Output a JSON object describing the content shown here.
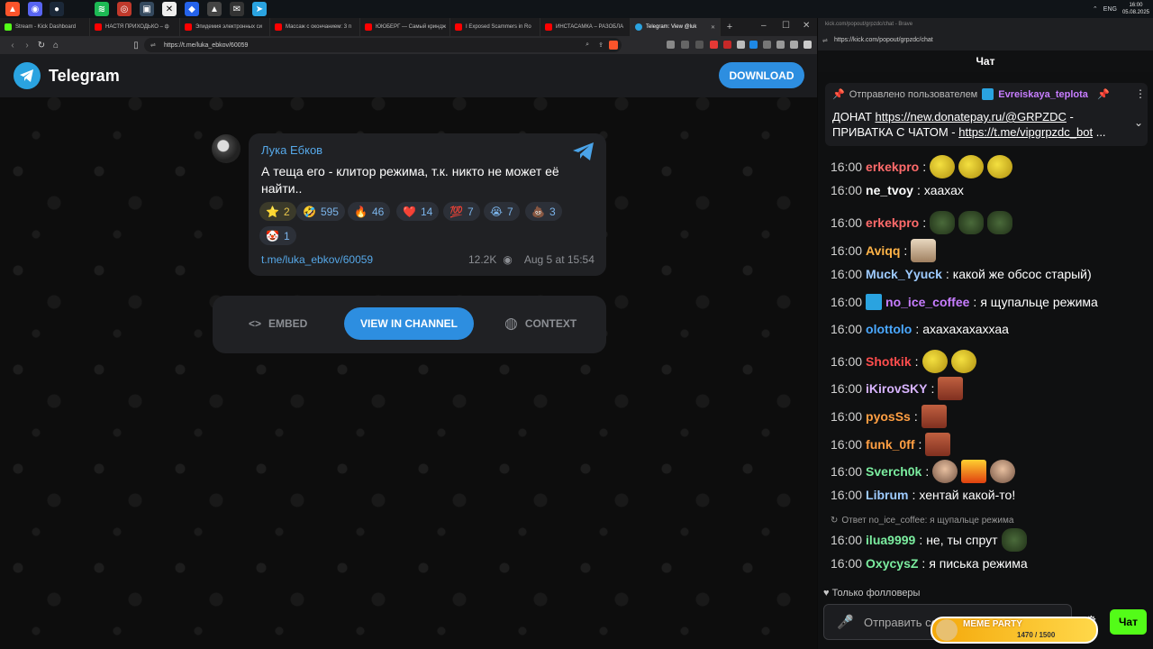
{
  "taskbar": {
    "lang": "ENG",
    "time": "16:00",
    "date": "05.08.2025"
  },
  "browser": {
    "tabs": [
      {
        "label": "Stream - Kick Dashboard",
        "color": "#53fc18"
      },
      {
        "label": "НАСТЯ ПРИХОДЬКО – ф",
        "color": "#ff0000"
      },
      {
        "label": "Эпидемия электронных си",
        "color": "#ff0000"
      },
      {
        "label": "Массаж с окончанием: 3 п",
        "color": "#ff0000"
      },
      {
        "label": "ЮЮБЕРГ — Самый криндж",
        "color": "#ff0000"
      },
      {
        "label": "I Exposed Scammers in Ro",
        "color": "#ff0000"
      },
      {
        "label": "ИНСТАСАМКА – РАЗОБЛА",
        "color": "#ff0000"
      },
      {
        "label": "Telegram: View @luk",
        "color": "#2aa3e0",
        "active": true
      }
    ],
    "url": "https://t.me/luka_ebkov/60059"
  },
  "telegram": {
    "brand": "Telegram",
    "download_label": "DOWNLOAD",
    "post": {
      "author": "Лука Ебков",
      "text": "А теща его - клитор режима, т.к. никто не может её найти..",
      "reactions": [
        {
          "emoji": "⭐",
          "count": "2"
        },
        {
          "emoji": "🤣",
          "count": "595"
        },
        {
          "emoji": "🔥",
          "count": "46"
        },
        {
          "emoji": "❤️",
          "count": "14"
        },
        {
          "emoji": "💯",
          "count": "7"
        },
        {
          "emoji": "😭",
          "count": "7"
        },
        {
          "emoji": "💩",
          "count": "3"
        },
        {
          "emoji": "🤡",
          "count": "1"
        }
      ],
      "link": "t.me/luka_ebkov/60059",
      "views": "12.2K",
      "date": "Aug 5 at 15:54"
    },
    "actions": {
      "embed": "EMBED",
      "view": "VIEW IN CHANNEL",
      "context": "CONTEXT"
    }
  },
  "kick": {
    "window_title": "kick.com/popout/grpzdc/chat - Brave",
    "url": "https://kick.com/popout/grpzdc/chat",
    "header": "Чат",
    "pinned": {
      "by_label": "Отправлено пользователем",
      "by_user": "Evreiskaya_teplota",
      "text1": "ДОНАТ ",
      "link1": "https://new.donatepay.ru/@GRPZDC",
      "text2": " - ПРИВАТКА С ЧАТОМ - ",
      "link2": "https://t.me/vipgrpzdc_bot",
      "ellipsis": " ..."
    },
    "messages": [
      {
        "time": "16:00",
        "user": "erkekpro",
        "color": "#ff6b6b",
        "text": "",
        "emotes": [
          "",
          "",
          ""
        ]
      },
      {
        "time": "16:00",
        "user": "ne_tvoy",
        "color": "#ffffff",
        "text": "хаахах",
        "emotes": []
      },
      {
        "time": "16:00",
        "user": "erkekpro",
        "color": "#ff6b6b",
        "text": "",
        "emotes": [
          "frog",
          "frog",
          "frog"
        ]
      },
      {
        "time": "16:00",
        "user": "Aviqq",
        "color": "#ffb347",
        "text": "",
        "emotes": [
          "cat"
        ]
      },
      {
        "time": "16:00",
        "user": "Muck_Yyuck",
        "color": "#9ecbff",
        "text": "какой же обсос старый)",
        "emotes": []
      },
      {
        "time": "16:00",
        "user": "no_ice_coffee",
        "color": "#c77dff",
        "text": "я щупальце режима",
        "emotes": []
      },
      {
        "time": "16:00",
        "user": "olottolo",
        "color": "#4aa8ff",
        "text": "ахахахахаххаа",
        "emotes": []
      },
      {
        "time": "16:00",
        "user": "Shotkik",
        "color": "#ff4d4d",
        "text": "",
        "emotes": [
          "",
          ""
        ]
      },
      {
        "time": "16:00",
        "user": "iKirovSKY",
        "color": "#d8b4ff",
        "text": "",
        "emotes": [
          "face"
        ]
      },
      {
        "time": "16:00",
        "user": "pyosSs",
        "color": "#ff9f43",
        "text": "",
        "emotes": [
          "face"
        ]
      },
      {
        "time": "16:00",
        "user": "funk_0ff",
        "color": "#ff9f43",
        "text": "",
        "emotes": [
          "face"
        ]
      },
      {
        "time": "16:00",
        "user": "Sverch0k",
        "color": "#7bed9f",
        "text": "",
        "emotes": [
          "old",
          "fire",
          "old"
        ]
      },
      {
        "time": "16:00",
        "user": "Librum",
        "color": "#9ecbff",
        "text": "хентай какой-то!",
        "emotes": []
      },
      {
        "time": "16:00",
        "user": "ilua9999",
        "color": "#7bed9f",
        "text": "не, ты спрут",
        "emotes": [
          "frog"
        ]
      },
      {
        "time": "16:00",
        "user": "OxycysZ",
        "color": "#7bed9f",
        "text": "я писька режима",
        "emotes": []
      }
    ],
    "reply_label": "Ответ no_ice_coffee: я щупальце режима",
    "followers_only": "Только фолловеры",
    "input_placeholder": "Отправить со",
    "send_label": "Чат",
    "meme_party": {
      "label": "MEME PARTY",
      "progress": "1470 / 1500"
    }
  }
}
